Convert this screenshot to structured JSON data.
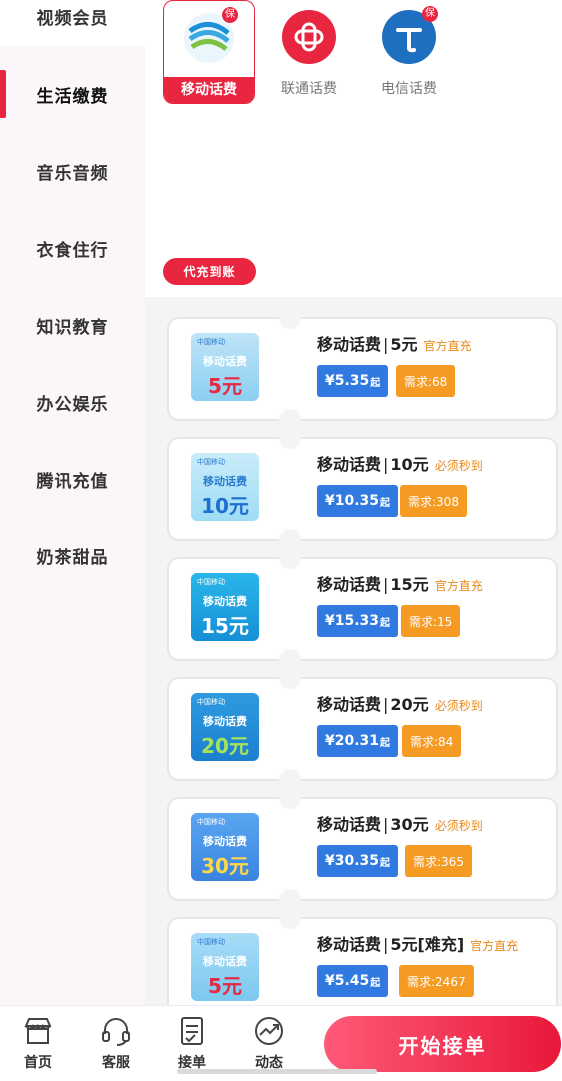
{
  "sidebar": {
    "items": [
      {
        "label": "视频会员"
      },
      {
        "label": "生活缴费"
      },
      {
        "label": "音乐音频"
      },
      {
        "label": "衣食住行"
      },
      {
        "label": "知识教育"
      },
      {
        "label": "办公娱乐"
      },
      {
        "label": "腾讯充值"
      },
      {
        "label": "奶茶甜品"
      }
    ],
    "active_index": 1
  },
  "operators": [
    {
      "name": "移动话费",
      "badge": "保",
      "selected": true
    },
    {
      "name": "联通话费",
      "badge": "",
      "selected": false
    },
    {
      "name": "电信话费",
      "badge": "保",
      "selected": false
    }
  ],
  "tag_pill": "代充到账",
  "cards": [
    {
      "thumb_brand": "中国移动",
      "thumb_line1": "移动话费",
      "thumb_line2": "5元",
      "title": "移动话费",
      "sep": "|",
      "amount": "5元",
      "note": "官方直充",
      "price": "¥5.35",
      "price_suffix": "起",
      "need": "需求:68"
    },
    {
      "thumb_brand": "中国移动",
      "thumb_line1": "移动话费",
      "thumb_line2": "10元",
      "title": "移动话费",
      "sep": "|",
      "amount": "10元",
      "note": "必须秒到",
      "price": "¥10.35",
      "price_suffix": "起",
      "need": "需求:308"
    },
    {
      "thumb_brand": "中国移动",
      "thumb_line1": "移动话费",
      "thumb_line2": "15元",
      "title": "移动话费",
      "sep": "|",
      "amount": "15元",
      "note": "官方直充",
      "price": "¥15.33",
      "price_suffix": "起",
      "need": "需求:15"
    },
    {
      "thumb_brand": "中国移动",
      "thumb_line1": "移动话费",
      "thumb_line2": "20元",
      "title": "移动话费",
      "sep": "|",
      "amount": "20元",
      "note": "必须秒到",
      "price": "¥20.31",
      "price_suffix": "起",
      "need": "需求:84"
    },
    {
      "thumb_brand": "中国移动",
      "thumb_line1": "移动话费",
      "thumb_line2": "30元",
      "title": "移动话费",
      "sep": "|",
      "amount": "30元",
      "note": "必须秒到",
      "price": "¥30.35",
      "price_suffix": "起",
      "need": "需求:365"
    },
    {
      "thumb_brand": "中国移动",
      "thumb_line1": "移动话费",
      "thumb_line2": "5元",
      "title": "移动话费",
      "sep": "|",
      "amount": "5元[难充]",
      "note": "官方直充",
      "price": "¥5.45",
      "price_suffix": "起",
      "need": "需求:2467"
    }
  ],
  "bottom_nav": {
    "tabs": [
      {
        "label": "首页",
        "icon": "shop-icon"
      },
      {
        "label": "客服",
        "icon": "headset-icon"
      },
      {
        "label": "接单",
        "icon": "clipboard-icon"
      },
      {
        "label": "动态",
        "icon": "trend-icon"
      }
    ],
    "start_button": "开始接单"
  },
  "colors": {
    "accent": "#e8263f",
    "price_blue": "#2f79e0",
    "need_orange": "#f59a23",
    "note_orange": "#e8891a"
  }
}
